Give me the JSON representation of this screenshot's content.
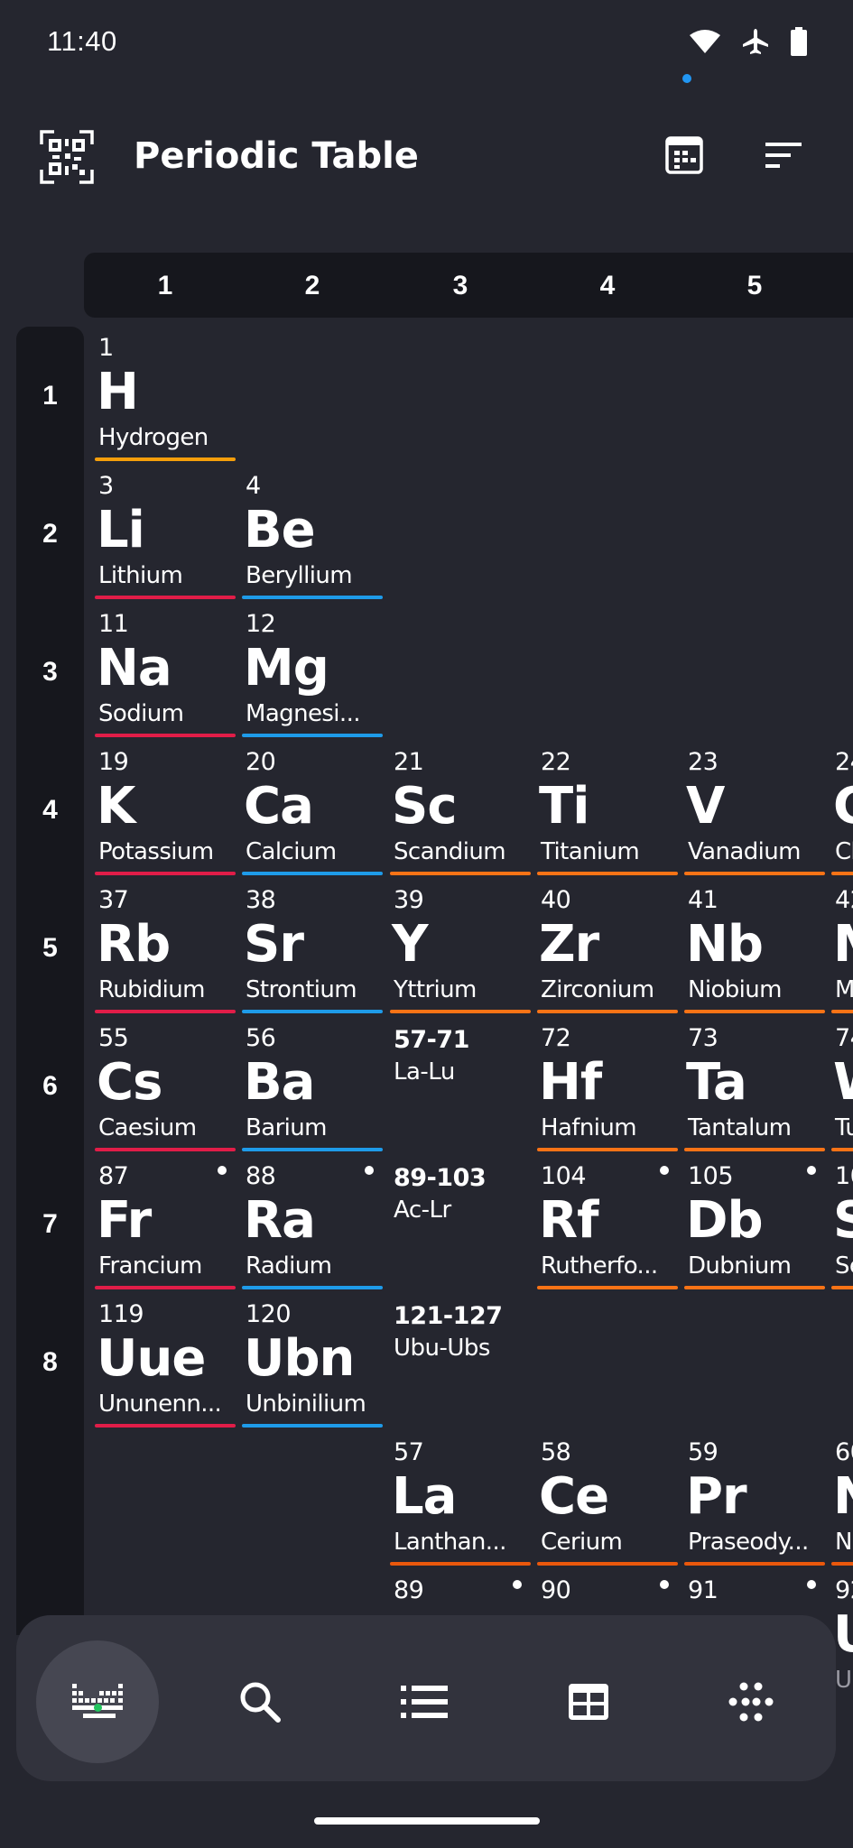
{
  "status_bar": {
    "time": "11:40"
  },
  "app_bar": {
    "title": "Periodic Table"
  },
  "groups": [
    "1",
    "2",
    "3",
    "4",
    "5"
  ],
  "periods": [
    "1",
    "2",
    "3",
    "4",
    "5",
    "6",
    "7",
    "8"
  ],
  "colors": {
    "background": "#25262f",
    "panel": "#16171d",
    "nonmetal": "#f59e0b",
    "alkali_metal": "#e11d48",
    "alkaline_earth": "#1e9be9",
    "transition_metal": "#f97316",
    "lanthanide": "#ea580c",
    "active_indicator": "#2196f3",
    "nav_dot": "#22c55e"
  },
  "elements": [
    {
      "num": "1",
      "sym": "H",
      "name": "Hydrogen"
    },
    {
      "num": "3",
      "sym": "Li",
      "name": "Lithium"
    },
    {
      "num": "4",
      "sym": "Be",
      "name": "Beryllium"
    },
    {
      "num": "11",
      "sym": "Na",
      "name": "Sodium"
    },
    {
      "num": "12",
      "sym": "Mg",
      "name": "Magnesi..."
    },
    {
      "num": "19",
      "sym": "K",
      "name": "Potassium"
    },
    {
      "num": "20",
      "sym": "Ca",
      "name": "Calcium"
    },
    {
      "num": "21",
      "sym": "Sc",
      "name": "Scandium"
    },
    {
      "num": "22",
      "sym": "Ti",
      "name": "Titanium"
    },
    {
      "num": "23",
      "sym": "V",
      "name": "Vanadium"
    },
    {
      "num": "24",
      "sym": "C",
      "name": "Ch"
    },
    {
      "num": "37",
      "sym": "Rb",
      "name": "Rubidium"
    },
    {
      "num": "38",
      "sym": "Sr",
      "name": "Strontium"
    },
    {
      "num": "39",
      "sym": "Y",
      "name": "Yttrium"
    },
    {
      "num": "40",
      "sym": "Zr",
      "name": "Zirconium"
    },
    {
      "num": "41",
      "sym": "Nb",
      "name": "Niobium"
    },
    {
      "num": "42",
      "sym": "M",
      "name": "M"
    },
    {
      "num": "55",
      "sym": "Cs",
      "name": "Caesium"
    },
    {
      "num": "56",
      "sym": "Ba",
      "name": "Barium"
    },
    {
      "num": "72",
      "sym": "Hf",
      "name": "Hafnium"
    },
    {
      "num": "73",
      "sym": "Ta",
      "name": "Tantalum"
    },
    {
      "num": "74",
      "sym": "W",
      "name": "Tu"
    },
    {
      "num": "87",
      "sym": "Fr",
      "name": "Francium"
    },
    {
      "num": "88",
      "sym": "Ra",
      "name": "Radium"
    },
    {
      "num": "104",
      "sym": "Rf",
      "name": "Rutherfo..."
    },
    {
      "num": "105",
      "sym": "Db",
      "name": "Dubnium"
    },
    {
      "num": "10",
      "sym": "S",
      "name": "Se"
    },
    {
      "num": "119",
      "sym": "Uue",
      "name": "Ununenn..."
    },
    {
      "num": "120",
      "sym": "Ubn",
      "name": "Unbinilium"
    },
    {
      "num": "57",
      "sym": "La",
      "name": "Lanthan..."
    },
    {
      "num": "58",
      "sym": "Ce",
      "name": "Cerium"
    },
    {
      "num": "59",
      "sym": "Pr",
      "name": "Praseody..."
    },
    {
      "num": "60",
      "sym": "N",
      "name": "Ne"
    },
    {
      "num": "89",
      "sym": "",
      "name": ""
    },
    {
      "num": "90",
      "sym": "",
      "name": ""
    },
    {
      "num": "91",
      "sym": "",
      "name": ""
    },
    {
      "num": "92",
      "sym": "U",
      "name": "Ur"
    }
  ],
  "ranges": [
    {
      "num": "57-71",
      "label": "La-Lu"
    },
    {
      "num": "89-103",
      "label": "Ac-Lr"
    },
    {
      "num": "121-127",
      "label": "Ubu-Ubs"
    }
  ],
  "bottom_nav": {
    "items": [
      "periodic-table",
      "search",
      "list",
      "table",
      "molar-mass"
    ],
    "active": "periodic-table"
  }
}
